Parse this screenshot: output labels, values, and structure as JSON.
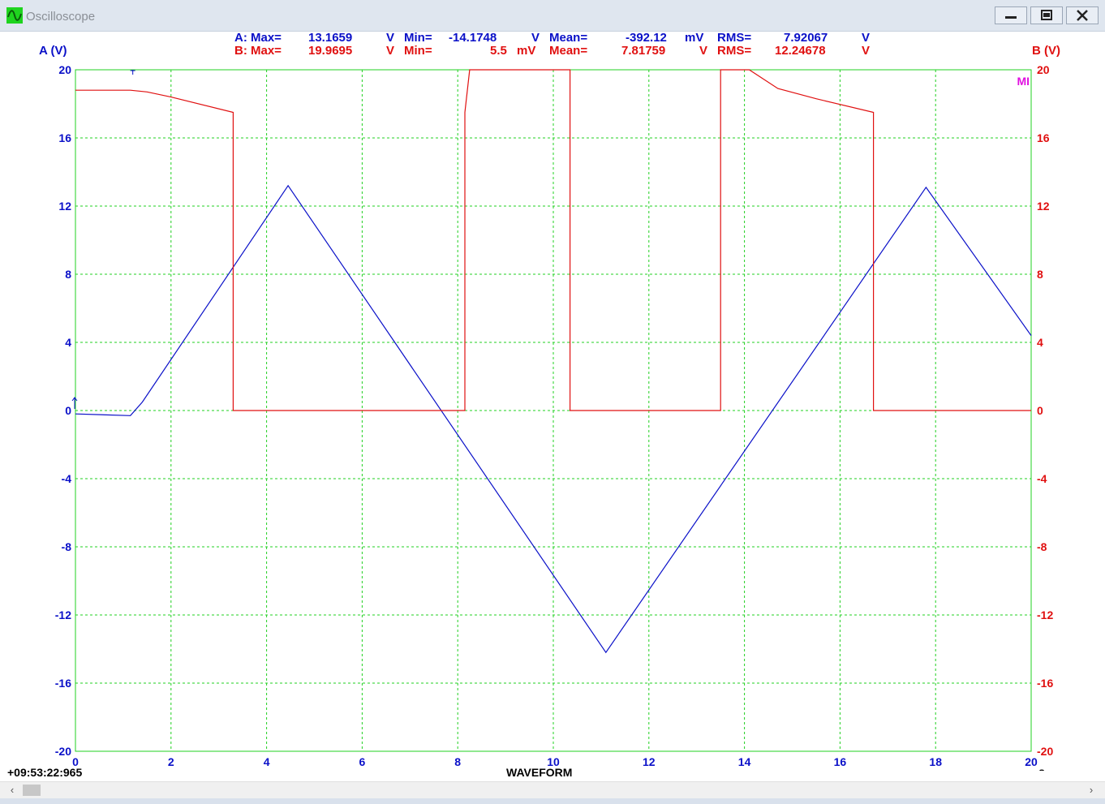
{
  "window": {
    "title": "Oscilloscope",
    "minimize_symbol": "—",
    "maximize_symbol": "□",
    "close_symbol": "✕"
  },
  "stats": {
    "a": {
      "prefix": "A: Max=",
      "max": "13.1659",
      "max_unit": "V",
      "min_label": "Min=",
      "min": "-14.1748",
      "min_unit": "V",
      "mean_label": "Mean=",
      "mean": "-392.12",
      "mean_unit": "mV",
      "rms_label": "RMS=",
      "rms": "7.92067",
      "rms_unit": "V"
    },
    "b": {
      "prefix": "B: Max=",
      "max": "19.9695",
      "max_unit": "V",
      "min_label": "Min=",
      "min": "5.5",
      "min_unit": "mV",
      "mean_label": "Mean=",
      "mean": "7.81759",
      "mean_unit": "V",
      "rms_label": "RMS=",
      "rms": "12.24678",
      "rms_unit": "V"
    }
  },
  "left_axis_title": "A (V)",
  "right_axis_title": "B (V)",
  "mi_label": "MI",
  "timestamp": "+09:53:22:965",
  "xlabel": "WAVEFORM",
  "xunit": "s",
  "colors": {
    "channel_a": "#0a10c8",
    "channel_b": "#e01010",
    "grid": "#20d020",
    "marker": "#e010e0"
  },
  "chart_data": {
    "type": "line",
    "x_ticks": [
      "0",
      "2",
      "4",
      "6",
      "8",
      "10",
      "12",
      "14",
      "16",
      "18",
      "20"
    ],
    "y_ticks": [
      "20",
      "16",
      "12",
      "8",
      "4",
      "0",
      "-4",
      "-8",
      "-12",
      "-16",
      "-20"
    ],
    "xlim": [
      0,
      20
    ],
    "ylim": [
      -20,
      20
    ],
    "grid": true,
    "series": [
      {
        "name": "A",
        "axis": "left",
        "x": [
          0,
          1.15,
          1.4,
          4.45,
          11.1,
          17.8,
          20
        ],
        "y": [
          -0.2,
          -0.3,
          0.5,
          13.2,
          -14.2,
          13.1,
          4.4
        ]
      },
      {
        "name": "B",
        "axis": "right",
        "x": [
          0,
          1.15,
          1.5,
          2.0,
          3.3,
          3.3,
          8.15,
          8.15,
          8.25,
          10.35,
          10.35,
          13.5,
          13.5,
          14.1,
          14.7,
          15.5,
          16.7,
          16.7,
          20
        ],
        "y": [
          18.8,
          18.8,
          18.7,
          18.4,
          17.5,
          0,
          0,
          17.5,
          20,
          20,
          0,
          0,
          20,
          20,
          18.9,
          18.3,
          17.5,
          0,
          0
        ]
      }
    ]
  }
}
